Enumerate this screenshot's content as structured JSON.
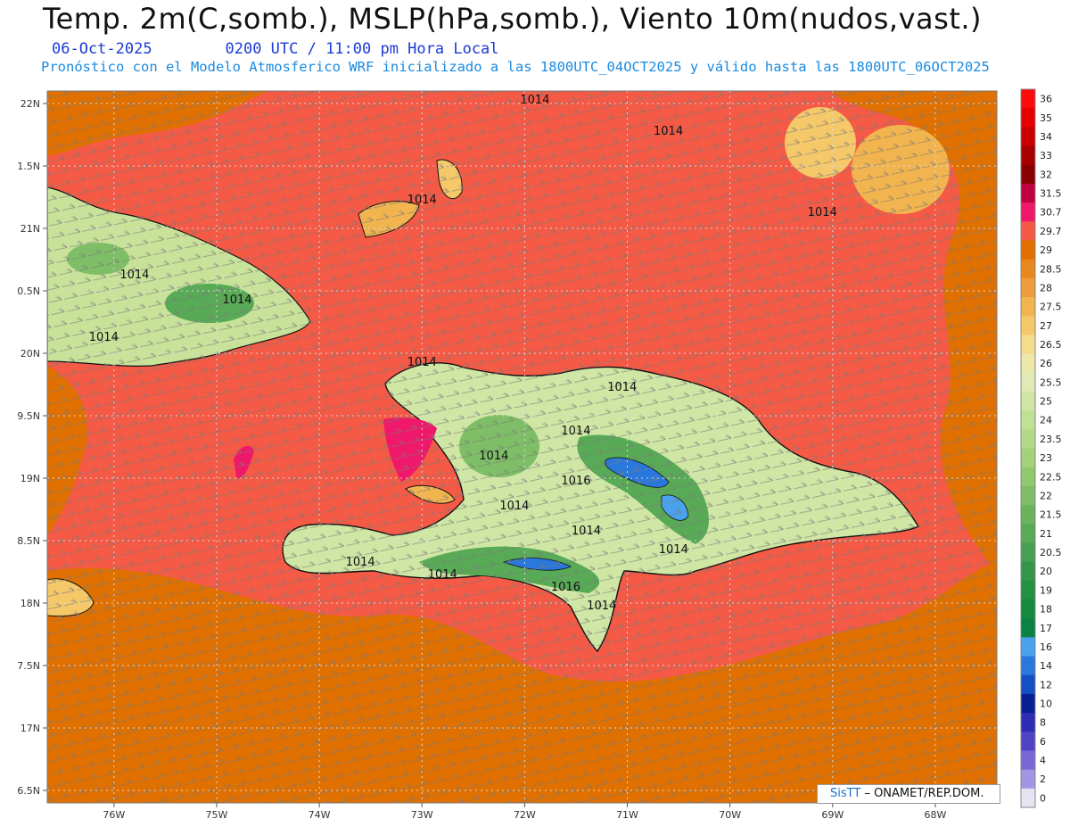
{
  "header": {
    "title": "Temp. 2m(C,somb.), MSLP(hPa,somb.), Viento 10m(nudos,vast.)",
    "date": "06-Oct-2025",
    "time": "0200 UTC / 11:00 pm Hora Local",
    "description": "Pronóstico con el Modelo Atmosferico WRF inicializado a las 1800UTC_04OCT2025 y válido hasta las  1800UTC_06OCT2025"
  },
  "axes": {
    "lat_labels": [
      "22N",
      "1.5N",
      "21N",
      "0.5N",
      "20N",
      "9.5N",
      "19N",
      "8.5N",
      "18N",
      "7.5N",
      "17N",
      "6.5N"
    ],
    "lat_values": [
      22,
      21.5,
      21,
      20.5,
      20,
      19.5,
      19,
      18.5,
      18,
      17.5,
      17,
      16.5
    ],
    "lon_labels": [
      "76W",
      "75W",
      "74W",
      "73W",
      "72W",
      "71W",
      "70W",
      "69W",
      "68W"
    ],
    "lon_values": [
      -76,
      -75,
      -74,
      -73,
      -72,
      -71,
      -70,
      -69,
      -68
    ]
  },
  "pressure_labels": [
    {
      "text": "1014",
      "lon": -71.9,
      "lat": 22.0
    },
    {
      "text": "1014",
      "lon": -70.6,
      "lat": 21.75
    },
    {
      "text": "1014",
      "lon": -73.0,
      "lat": 21.2
    },
    {
      "text": "1014",
      "lon": -69.1,
      "lat": 21.1
    },
    {
      "text": "1014",
      "lon": -75.8,
      "lat": 20.6
    },
    {
      "text": "1014",
      "lon": -74.8,
      "lat": 20.4
    },
    {
      "text": "1014",
      "lon": -76.1,
      "lat": 20.1
    },
    {
      "text": "1014",
      "lon": -73.0,
      "lat": 19.9
    },
    {
      "text": "1014",
      "lon": -71.05,
      "lat": 19.7
    },
    {
      "text": "1014",
      "lon": -71.5,
      "lat": 19.35
    },
    {
      "text": "1014",
      "lon": -72.3,
      "lat": 19.15
    },
    {
      "text": "1016",
      "lon": -71.5,
      "lat": 18.95
    },
    {
      "text": "1014",
      "lon": -72.1,
      "lat": 18.75
    },
    {
      "text": "1014",
      "lon": -71.4,
      "lat": 18.55
    },
    {
      "text": "1014",
      "lon": -70.55,
      "lat": 18.4
    },
    {
      "text": "1014",
      "lon": -73.6,
      "lat": 18.3
    },
    {
      "text": "1014",
      "lon": -72.8,
      "lat": 18.2
    },
    {
      "text": "1016",
      "lon": -71.6,
      "lat": 18.1
    },
    {
      "text": "1014",
      "lon": -71.25,
      "lat": 17.95
    }
  ],
  "colorbar": {
    "labels": [
      "36",
      "35",
      "34",
      "33",
      "32",
      "31.5",
      "30.7",
      "29.7",
      "29",
      "28.5",
      "28",
      "27.5",
      "27",
      "26.5",
      "26",
      "25.5",
      "25",
      "24",
      "23.5",
      "23",
      "22.5",
      "22",
      "21.5",
      "21",
      "20.5",
      "20",
      "19",
      "18",
      "17",
      "16",
      "14",
      "12",
      "10",
      "8",
      "6",
      "4",
      "2",
      "0"
    ],
    "colors": [
      "#ff0a0a",
      "#e60000",
      "#c80000",
      "#a80000",
      "#880000",
      "#c00040",
      "#f0186a",
      "#f45a45",
      "#e07000",
      "#e8881c",
      "#ee9c3c",
      "#f2b44e",
      "#f5c86a",
      "#f4dc8c",
      "#ece8a8",
      "#dfeab4",
      "#cfe6a4",
      "#c0e094",
      "#b2da86",
      "#a2d27a",
      "#90c86e",
      "#7ebe66",
      "#6ab45e",
      "#58aa56",
      "#46a050",
      "#34964a",
      "#249044",
      "#138a3c",
      "#0a8246",
      "#4aa2ee",
      "#2a78dc",
      "#1450c4",
      "#0a2090",
      "#2e2cb4",
      "#5044c4",
      "#7a66d4",
      "#a494e4",
      "#e4e4f2"
    ]
  },
  "credit": {
    "brand": "SisTT",
    "org": "– ONAMET/REP.DOM."
  },
  "colors": {
    "sea_warm": "#f45a45",
    "sea_cool": "#e07000",
    "wind_barb": "#7a7a7a",
    "title_blue": "#1a3ad6",
    "desc_blue": "#1a8ae0"
  }
}
